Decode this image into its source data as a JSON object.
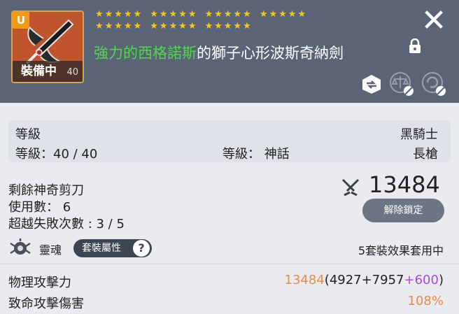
{
  "header": {
    "rarity_badge": "U",
    "equip_label": "裝備中",
    "equip_level": "40",
    "star_rows": [
      [
        "★★★★★",
        "★★★★★",
        "★★★★★",
        "★★★★★"
      ],
      [
        "★★★★★",
        "★★★★★",
        "★★★★★"
      ]
    ],
    "name_potential": "強力的西格諾斯",
    "name_rest": "的獅子心形波斯奇納劍",
    "close_glyph": "✕"
  },
  "info": {
    "level_header": "等級",
    "job": "黑騎士",
    "level_value": "等級：40 / 40",
    "grade": "等級： 神話",
    "weapon_type": "長槍"
  },
  "scissors": {
    "remaining_label": "剩餘神奇剪刀",
    "use_count": "使用數： 6",
    "transcend_fails": "超越失敗次數 : 3 / 5"
  },
  "power": {
    "value": "13484",
    "unlock_button": "解除鎖定"
  },
  "soul": {
    "label": "靈魂",
    "set_button": "套裝屬性",
    "help": "?",
    "set_status": "5套裝效果套用中"
  },
  "stats": [
    {
      "name": "物理攻擊力",
      "total": "13484",
      "open": "(",
      "base": "4927+7957",
      "bonus": "+600",
      "close": ")"
    },
    {
      "name": "致命攻擊傷害",
      "value": "108%"
    }
  ],
  "colors": {
    "header_bg": "#5a6476",
    "potential_green": "#4fd84a",
    "star_gold": "#f5c916",
    "orange_value": "#e88a4a",
    "purple_bonus": "#a64be0"
  }
}
